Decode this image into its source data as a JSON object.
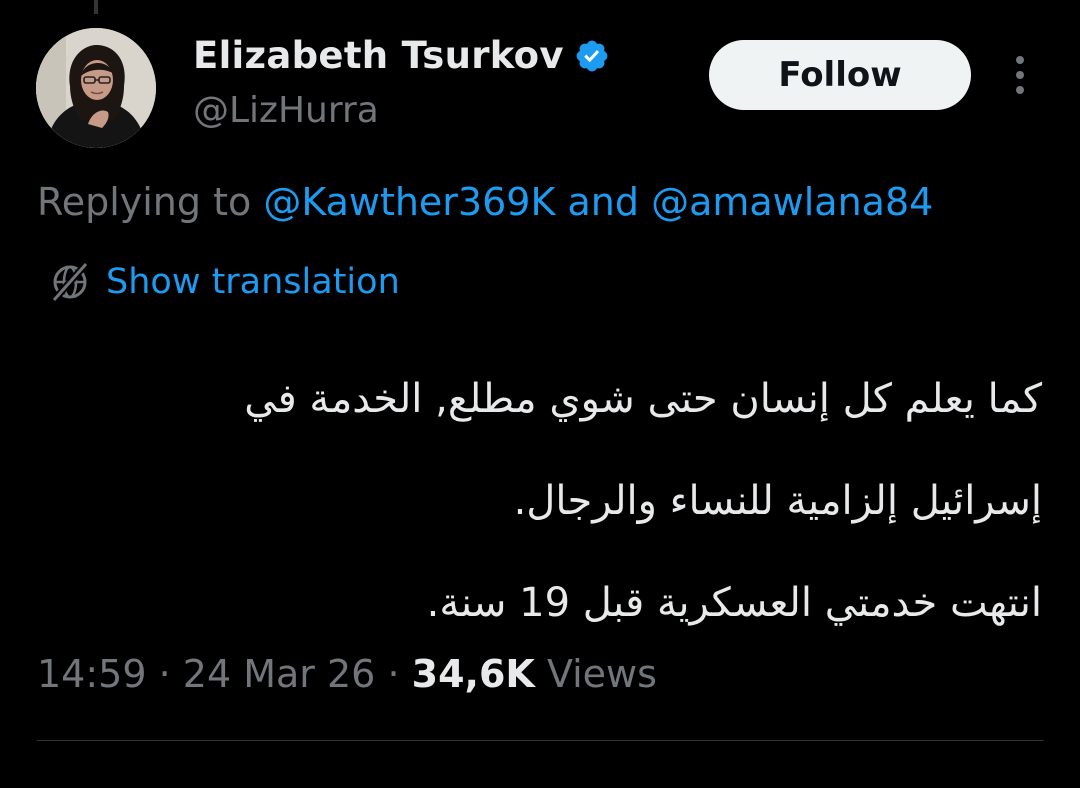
{
  "colors": {
    "background": "#000000",
    "text_primary": "#e7e9ea",
    "text_secondary": "#71767b",
    "accent_blue": "#1d9bf0",
    "follow_button_bg": "#eff3f4",
    "divider": "#2f3336"
  },
  "author": {
    "display_name": "Elizabeth Tsurkov",
    "handle": "@LizHurra",
    "verified_icon": "verified-badge-icon",
    "avatar_icon": "avatar"
  },
  "actions": {
    "follow_label": "Follow",
    "more_icon": "more-vertical-icon"
  },
  "reply_context": {
    "prefix": "Replying to",
    "mention_1": "@Kawther369K",
    "conjunction": "and",
    "mention_2": "@amawlana84"
  },
  "translation": {
    "icon": "globe-slash-icon",
    "label": "Show translation"
  },
  "tweet": {
    "lines": [
      "كما يعلم كل إنسان حتى شوي مطلع, الخدمة في",
      "إسرائيل إلزامية للنساء والرجال.",
      "انتهت خدمتي العسكرية قبل 19 سنة."
    ]
  },
  "meta": {
    "time": "14:59",
    "separator": "·",
    "date": "24 Mar 26",
    "views_count": "34,6K",
    "views_label": "Views"
  }
}
